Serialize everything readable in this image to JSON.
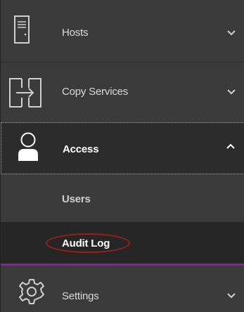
{
  "menu": {
    "items": [
      {
        "id": "hosts",
        "label": "Hosts",
        "icon": "server-icon",
        "state": "collapsed"
      },
      {
        "id": "copy_services",
        "label": "Copy Services",
        "icon": "copy-arrow-icon",
        "state": "collapsed"
      },
      {
        "id": "access",
        "label": "Access",
        "icon": "user-icon",
        "state": "expanded",
        "children": [
          {
            "label": "Users"
          },
          {
            "label": "Audit Log",
            "selected": true
          }
        ]
      },
      {
        "id": "settings",
        "label": "Settings",
        "icon": "gear-icon",
        "state": "collapsed"
      }
    ]
  },
  "colors": {
    "background": "#3b3b3b",
    "selected_background": "#262626",
    "accent_underline": "#8a1fa0",
    "highlight_ring": "#9c1f1f"
  }
}
